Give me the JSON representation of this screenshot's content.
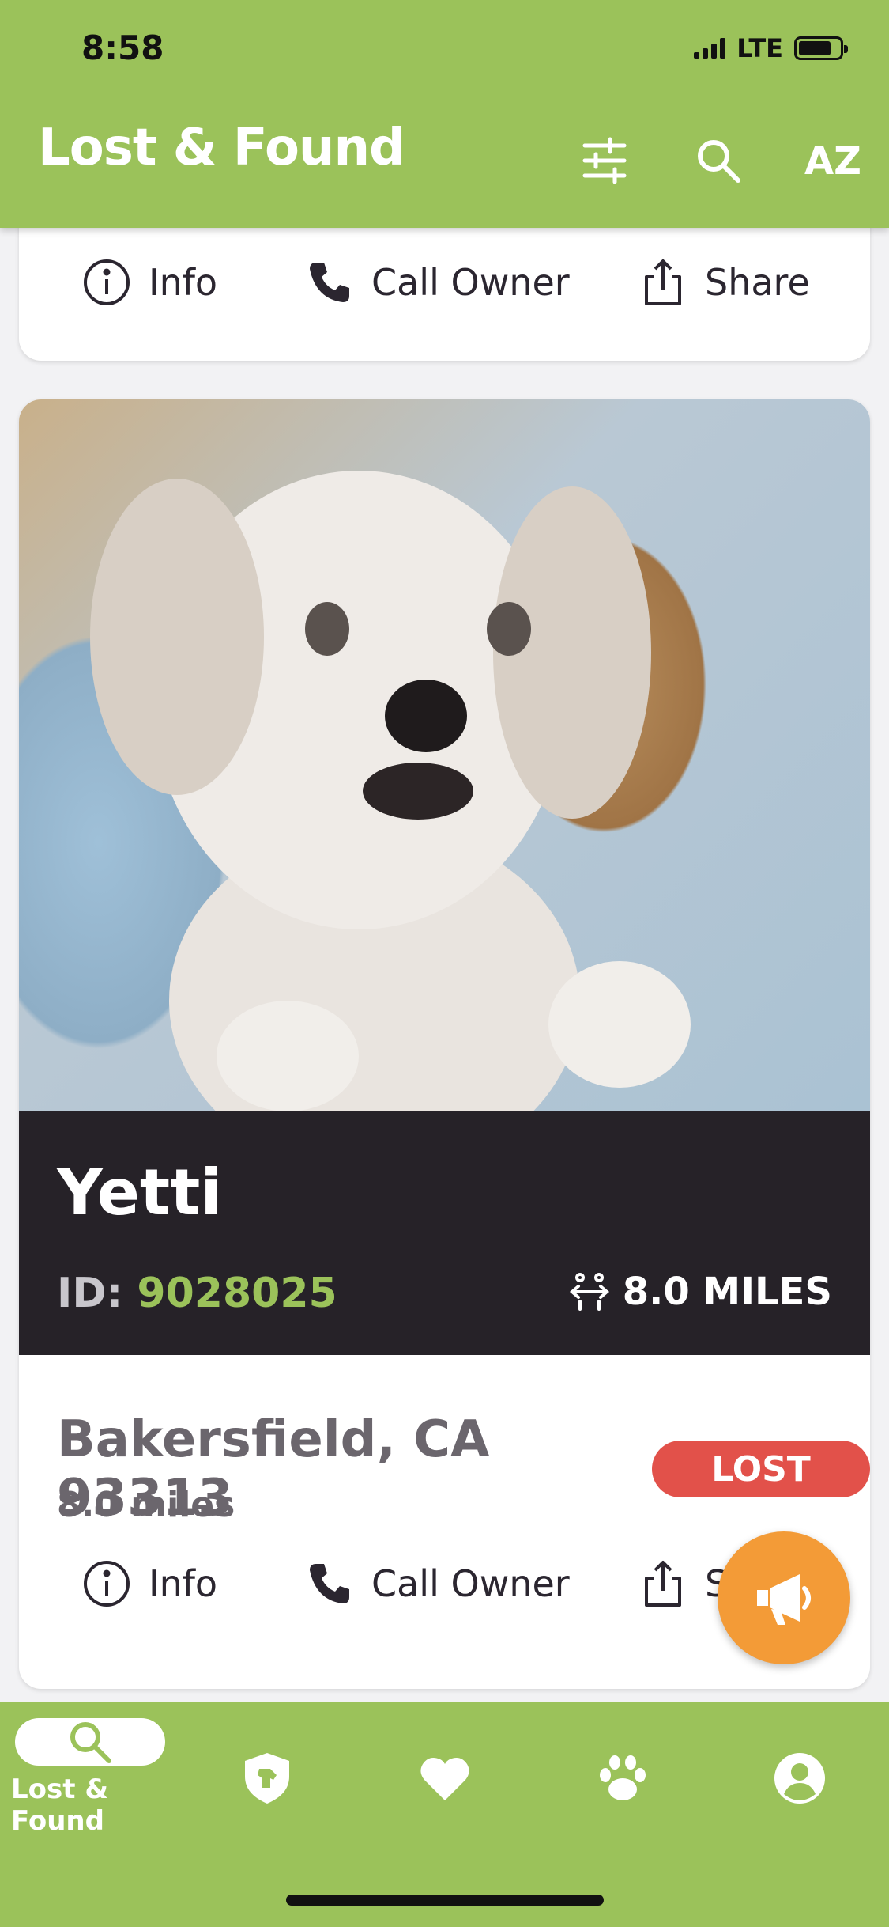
{
  "status_bar": {
    "time": "8:58",
    "network": "LTE"
  },
  "header": {
    "title": "Lost & Found",
    "sort_label": "AZ"
  },
  "top_card": {
    "actions": {
      "info": "Info",
      "call": "Call Owner",
      "share": "Share"
    }
  },
  "pet_card": {
    "name": "Yetti",
    "id_label": "ID:",
    "id_value": "9028025",
    "distance_badge": "8.0 MILES",
    "location": "Bakersfield, CA 93313",
    "status": "LOST",
    "miles": "8.0 miles",
    "actions": {
      "info": "Info",
      "call": "Call Owner",
      "share": "Share"
    }
  },
  "bottom_nav": {
    "items": [
      {
        "label": "Lost & Found",
        "icon": "search-icon",
        "active": true
      },
      {
        "icon": "shield-dog-icon"
      },
      {
        "icon": "heart-icon"
      },
      {
        "icon": "paw-icon"
      },
      {
        "icon": "profile-icon"
      }
    ]
  },
  "colors": {
    "brand_green": "#9bc25a",
    "lost_red": "#e2514a",
    "fab_orange": "#f39b37",
    "band_dark": "#262228"
  }
}
